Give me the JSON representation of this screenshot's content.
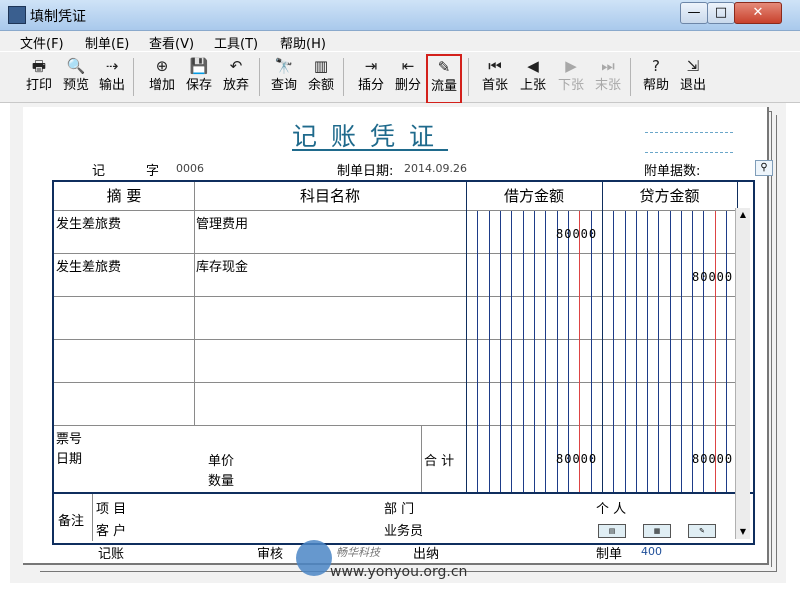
{
  "window": {
    "title": "填制凭证",
    "min": "—",
    "max": "□",
    "close": "✕"
  },
  "menu": [
    "文件(F)",
    "制单(E)",
    "查看(V)",
    "工具(T)",
    "帮助(H)"
  ],
  "toolbar": [
    {
      "label": "打印",
      "icon": "🖶",
      "icon_name": "print-icon"
    },
    {
      "label": "预览",
      "icon": "🔍",
      "icon_name": "preview-icon"
    },
    {
      "label": "输出",
      "icon": "⇢",
      "icon_name": "export-icon"
    },
    {
      "label": "增加",
      "icon": "⊕",
      "icon_name": "add-icon"
    },
    {
      "label": "保存",
      "icon": "💾",
      "icon_name": "save-icon"
    },
    {
      "label": "放弃",
      "icon": "↶",
      "icon_name": "undo-icon"
    },
    {
      "label": "查询",
      "icon": "🔭",
      "icon_name": "binoculars-icon"
    },
    {
      "label": "余额",
      "icon": "▥",
      "icon_name": "balance-chart-icon"
    },
    {
      "label": "插分",
      "icon": "⇥",
      "icon_name": "insert-line-icon"
    },
    {
      "label": "删分",
      "icon": "⇤",
      "icon_name": "delete-line-icon"
    },
    {
      "label": "流量",
      "icon": "✎",
      "icon_name": "cashflow-icon"
    },
    {
      "label": "首张",
      "icon": "⏮",
      "icon_name": "first-icon"
    },
    {
      "label": "上张",
      "icon": "◀",
      "icon_name": "prev-icon"
    },
    {
      "label": "下张",
      "icon": "▶",
      "icon_name": "next-icon"
    },
    {
      "label": "末张",
      "icon": "⏭",
      "icon_name": "last-icon"
    },
    {
      "label": "帮助",
      "icon": "?",
      "icon_name": "help-icon"
    },
    {
      "label": "退出",
      "icon": "⇲",
      "icon_name": "exit-icon"
    }
  ],
  "voucher": {
    "title": "记账凭证",
    "type_label": "记",
    "zi_label": "字",
    "number": "0006",
    "date_label": "制单日期:",
    "date": "2014.09.26",
    "attachments_label": "附单据数:",
    "headers": {
      "summary": "摘 要",
      "account": "科目名称",
      "debit": "借方金额",
      "credit": "贷方金额"
    },
    "entries": [
      {
        "summary": "发生差旅费",
        "account": "管理费用",
        "debit": "80000",
        "credit": ""
      },
      {
        "summary": "发生差旅费",
        "account": "库存现金",
        "debit": "",
        "credit": "80000"
      }
    ],
    "bill_no_label": "票号",
    "date_field_label": "日期",
    "unit_price_label": "单价",
    "quantity_label": "数量",
    "total_label": "合 计",
    "total_debit": "80000",
    "total_credit": "80000",
    "remark_label": "备注",
    "project_label": "项 目",
    "department_label": "部 门",
    "personal_label": "个 人",
    "customer_label": "客 户",
    "salesman_label": "业务员",
    "bookkeeping_label": "记账",
    "review_label": "审核",
    "cashier_label": "出纳",
    "preparer_label": "制单",
    "preparer": "400"
  },
  "watermark": {
    "brand": "畅华科技",
    "url": "www.yonyou.org.cn"
  },
  "colors": {
    "accent": "#1f6a8c",
    "grid_border": "#0f2e5e",
    "highlight": "#d3201b"
  }
}
